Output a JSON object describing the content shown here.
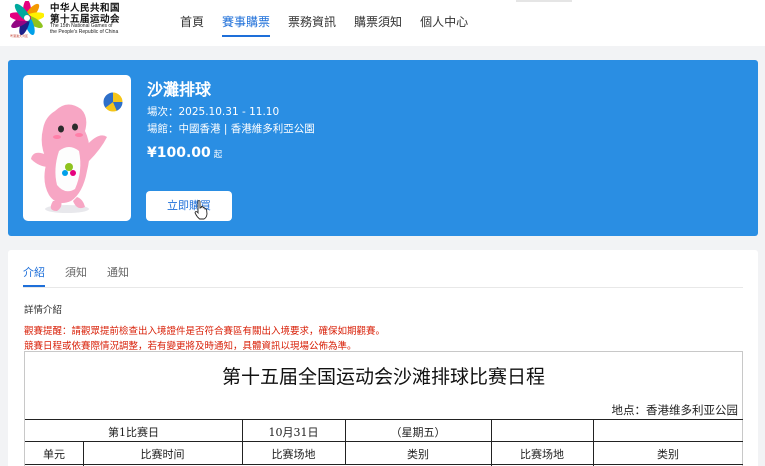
{
  "logo": {
    "cn_line1": "中华人民共和国",
    "cn_line2": "第十五届运动会",
    "en_line1": "The 15th National Games of",
    "en_line2": "the People's Republic of China",
    "sub": "粤港澳大湾区"
  },
  "nav": {
    "items": [
      {
        "label": "首頁"
      },
      {
        "label": "賽事購票"
      },
      {
        "label": "票務資訊"
      },
      {
        "label": "購票須知"
      },
      {
        "label": "個人中心"
      }
    ],
    "active_index": 1
  },
  "event": {
    "title": "沙灘排球",
    "date_line": "場次：2025.10.31 - 11.10",
    "venue_line": "場館：中國香港 | 香港維多利亞公園",
    "price": "¥100.00",
    "price_suffix": "起",
    "buy_label": "立即購買"
  },
  "tabs": [
    {
      "label": "介紹"
    },
    {
      "label": "須知"
    },
    {
      "label": "通知"
    }
  ],
  "details": {
    "title": "詳情介紹",
    "notice1": "觀賽提醒：請觀眾提前檢查出入境證件是否符合賽區有關出入境要求，確保如期觀賽。",
    "notice2": "競賽日程或依賽際情況調整，若有變更將及時通知，具體資訊以現場公佈為準。"
  },
  "schedule": {
    "title": "第十五届全国运动会沙滩排球比赛日程",
    "venue": "地点：香港维多利亚公园",
    "row1": [
      "第1比赛日",
      "10月31日",
      "（星期五）"
    ],
    "headers": [
      "单元",
      "比赛时间",
      "比赛场地",
      "类别",
      "比赛场地",
      "类别"
    ]
  },
  "colors": {
    "brand_blue": "#2a8ee3",
    "accent_blue": "#1e6fd9",
    "notice_red": "#d81e06"
  }
}
